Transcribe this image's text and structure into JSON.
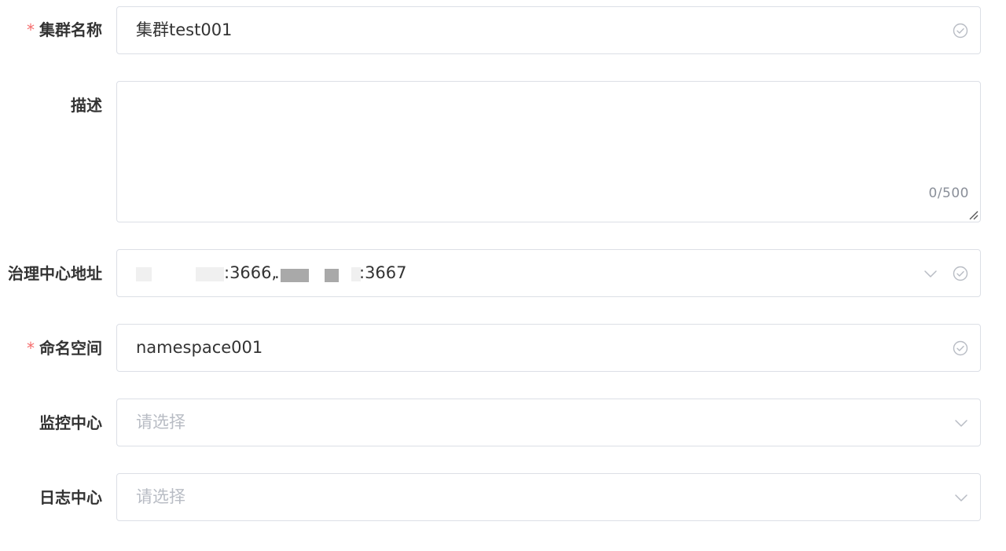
{
  "form": {
    "cluster_name": {
      "label": "集群名称",
      "required_mark": "*",
      "value": "集群test001"
    },
    "description": {
      "label": "描述",
      "value": "",
      "counter": "0/500"
    },
    "governance_address": {
      "label": "治理中心地址",
      "value_part1": ":3666,",
      "value_part2": ".",
      "value_part3": ":3667"
    },
    "namespace": {
      "label": "命名空间",
      "required_mark": "*",
      "value": "namespace001"
    },
    "monitor_center": {
      "label": "监控中心",
      "placeholder": "请选择"
    },
    "log_center": {
      "label": "日志中心",
      "placeholder": "请选择"
    }
  },
  "colors": {
    "required": "#f56c6c",
    "border": "#dcdfe6",
    "placeholder": "#b8bcc4",
    "text": "#333333"
  },
  "icons": [
    "check-circle-icon",
    "chevron-down-icon",
    "resize-handle-icon"
  ]
}
